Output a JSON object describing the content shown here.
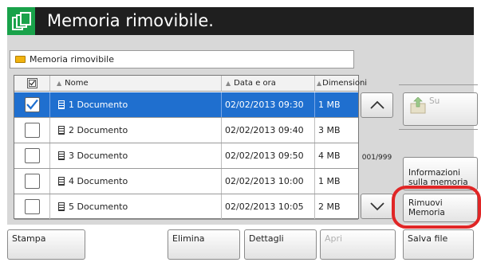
{
  "header": {
    "title": "Memoria rimovibile."
  },
  "path": {
    "label": "Memoria rimovibile"
  },
  "table": {
    "columns": {
      "name": "Nome",
      "datetime": "Data e ora",
      "size": "Dimensioni"
    },
    "rows": [
      {
        "name": "1 Documento",
        "datetime": "02/02/2013 09:30",
        "size": "1 MB",
        "checked": true,
        "selected": true
      },
      {
        "name": "2 Documento",
        "datetime": "02/02/2013 09:40",
        "size": "3 MB",
        "checked": false,
        "selected": false
      },
      {
        "name": "3 Documento",
        "datetime": "02/02/2013 09:50",
        "size": "4 MB",
        "checked": false,
        "selected": false
      },
      {
        "name": "4 Documento",
        "datetime": "02/02/2013 10:00",
        "size": "1 MB",
        "checked": false,
        "selected": false
      },
      {
        "name": "5 Documento",
        "datetime": "02/02/2013 10:05",
        "size": "2 MB",
        "checked": false,
        "selected": false
      }
    ]
  },
  "pager": {
    "counter": "001/999"
  },
  "sidebar": {
    "up_label": "Su",
    "info_label": "Informazioni sulla memoria",
    "remove_label": "Rimuovi Memoria"
  },
  "footer": {
    "print_label": "Stampa",
    "delete_label": "Elimina",
    "details_label": "Dettagli",
    "open_label": "Apri",
    "save_label": "Salva file"
  },
  "colors": {
    "title_bar": "#1f1f1f",
    "icon_bg": "#19a24a",
    "selection": "#1f6fcf",
    "highlight_ring": "#e02626"
  },
  "icons": [
    "copy-pages-icon",
    "folder-icon",
    "select-all-checkbox-icon",
    "document-icon",
    "scroll-up-icon",
    "scroll-down-icon",
    "folder-up-icon"
  ]
}
